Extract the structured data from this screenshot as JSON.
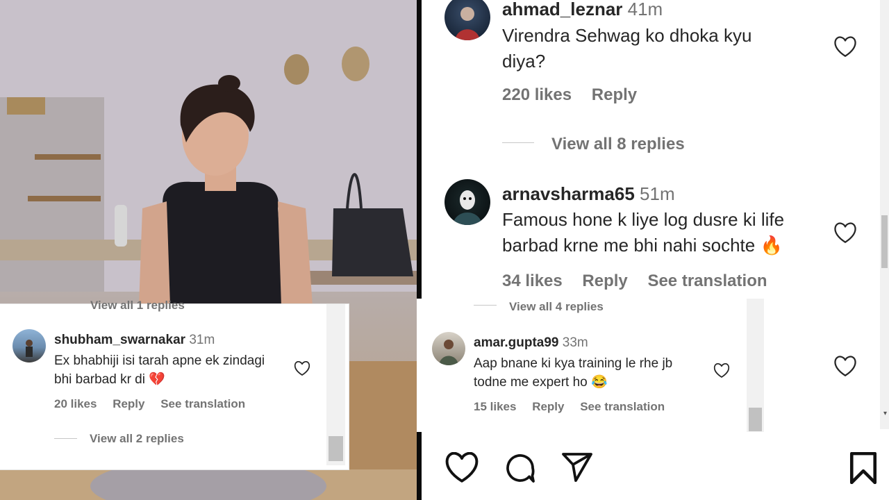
{
  "comments_main": [
    {
      "user": "ahmad_leznar",
      "time": "41m",
      "text_line1": "Virendra Sehwag ko dhoka kyu",
      "text_line2": "diya?",
      "likes": "220 likes",
      "reply": "Reply",
      "view_replies": "View all 8 replies"
    },
    {
      "user": "arnavsharma65",
      "time": "51m",
      "text_line1": "Famous hone k liye log dusre ki life",
      "text_line2": "barbad krne me bhi nahi sochte 🔥",
      "likes": "34 likes",
      "reply": "Reply",
      "translate": "See translation"
    }
  ],
  "overlay_left": {
    "top_partial": "View all 1 replies",
    "user": "shubham_swarnakar",
    "time": "31m",
    "text_line1": "Ex bhabhiji isi tarah apne ek zindagi",
    "text_line2": "bhi barbad kr di 💔",
    "likes": "20 likes",
    "reply": "Reply",
    "translate": "See translation",
    "view_replies": "View all 2 replies"
  },
  "overlay_mid": {
    "top_partial": "View all 4 replies",
    "user": "amar.gupta99",
    "time": "33m",
    "text_line1": "Aap bnane ki kya training le rhe jb",
    "text_line2": "todne me expert ho 😂",
    "likes": "15 likes",
    "reply": "Reply",
    "translate": "See translation"
  },
  "icons": [
    "heart-icon",
    "comment-icon",
    "share-icon",
    "bookmark-icon"
  ],
  "colors": {
    "text": "#262626",
    "muted": "#737373"
  }
}
